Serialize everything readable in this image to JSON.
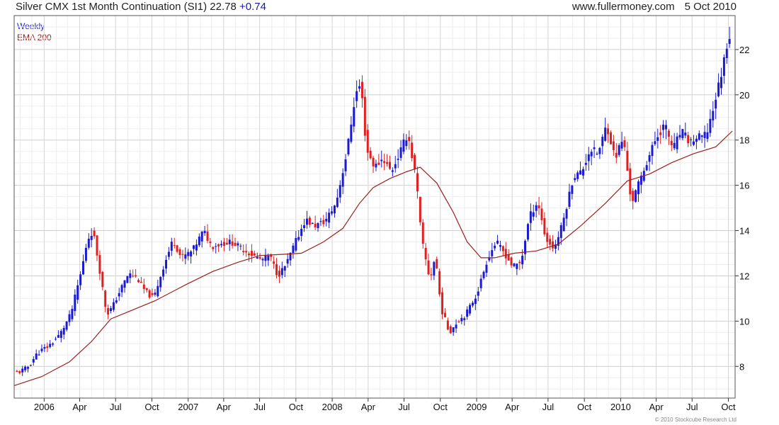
{
  "header": {
    "title": "Silver CMX 1st Month Continuation (SI1)",
    "last": "22.78",
    "change": "+0.74",
    "site": "www.fullermoney.com",
    "date": "5 Oct 2010"
  },
  "footer": {
    "copyright": "© 2010 Stockcube Research Ltd"
  },
  "chart_data": {
    "type": "candlestick",
    "period": "Weekly",
    "legend": [
      "Weekly",
      "EMA 200"
    ],
    "legend_placement": "top-left",
    "ylim": [
      6.6,
      23.5
    ],
    "yticks": [
      8,
      10,
      12,
      14,
      16,
      18,
      20,
      22
    ],
    "x_range": [
      "2005-10-17",
      "2010-10-18"
    ],
    "xticks": [
      {
        "date": "2006-01-01",
        "label": "2006"
      },
      {
        "date": "2006-04-01",
        "label": "Apr"
      },
      {
        "date": "2006-07-01",
        "label": "Jul"
      },
      {
        "date": "2006-10-01",
        "label": "Oct"
      },
      {
        "date": "2007-01-01",
        "label": "2007"
      },
      {
        "date": "2007-04-01",
        "label": "Apr"
      },
      {
        "date": "2007-07-01",
        "label": "Jul"
      },
      {
        "date": "2007-10-01",
        "label": "Oct"
      },
      {
        "date": "2008-01-01",
        "label": "2008"
      },
      {
        "date": "2008-04-01",
        "label": "Apr"
      },
      {
        "date": "2008-07-01",
        "label": "Jul"
      },
      {
        "date": "2008-10-01",
        "label": "Oct"
      },
      {
        "date": "2009-01-01",
        "label": "2009"
      },
      {
        "date": "2009-04-01",
        "label": "Apr"
      },
      {
        "date": "2009-07-01",
        "label": "Jul"
      },
      {
        "date": "2009-10-01",
        "label": "Oct"
      },
      {
        "date": "2010-01-01",
        "label": "2010"
      },
      {
        "date": "2010-04-01",
        "label": "Apr"
      },
      {
        "date": "2010-07-01",
        "label": "Jul"
      },
      {
        "date": "2010-10-01",
        "label": "Oct"
      }
    ],
    "grid": true,
    "colors": {
      "up": "#1a1ad0",
      "down": "#e02020",
      "ema": "#9b2020",
      "grid": "#d8d8d8"
    },
    "price_path": [
      [
        "2005-10-24",
        7.7
      ],
      [
        "2005-11-21",
        7.9
      ],
      [
        "2005-12-19",
        8.6
      ],
      [
        "2006-01-16",
        8.9
      ],
      [
        "2006-02-13",
        9.4
      ],
      [
        "2006-03-13",
        10.3
      ],
      [
        "2006-04-10",
        12.3
      ],
      [
        "2006-04-24",
        13.6
      ],
      [
        "2006-05-08",
        14.0
      ],
      [
        "2006-05-22",
        12.6
      ],
      [
        "2006-06-12",
        10.3
      ],
      [
        "2006-06-26",
        10.6
      ],
      [
        "2006-07-17",
        11.4
      ],
      [
        "2006-08-07",
        12.1
      ],
      [
        "2006-08-28",
        11.9
      ],
      [
        "2006-09-18",
        11.3
      ],
      [
        "2006-10-09",
        11.0
      ],
      [
        "2006-10-30",
        12.2
      ],
      [
        "2006-11-27",
        13.6
      ],
      [
        "2006-12-18",
        12.8
      ],
      [
        "2007-01-15",
        13.1
      ],
      [
        "2007-02-12",
        14.0
      ],
      [
        "2007-03-05",
        13.3
      ],
      [
        "2007-03-26",
        13.4
      ],
      [
        "2007-04-23",
        13.5
      ],
      [
        "2007-05-21",
        13.2
      ],
      [
        "2007-06-18",
        12.9
      ],
      [
        "2007-07-09",
        12.7
      ],
      [
        "2007-07-30",
        12.9
      ],
      [
        "2007-08-20",
        12.0
      ],
      [
        "2007-09-10",
        12.5
      ],
      [
        "2007-10-01",
        13.4
      ],
      [
        "2007-10-29",
        14.5
      ],
      [
        "2007-11-19",
        14.2
      ],
      [
        "2007-12-17",
        14.4
      ],
      [
        "2008-01-14",
        15.2
      ],
      [
        "2008-02-11",
        17.5
      ],
      [
        "2008-03-03",
        20.0
      ],
      [
        "2008-03-17",
        20.5
      ],
      [
        "2008-03-31",
        17.6
      ],
      [
        "2008-04-21",
        16.8
      ],
      [
        "2008-05-12",
        17.2
      ],
      [
        "2008-06-02",
        16.6
      ],
      [
        "2008-06-23",
        17.4
      ],
      [
        "2008-07-14",
        18.3
      ],
      [
        "2008-08-04",
        16.3
      ],
      [
        "2008-08-18",
        13.6
      ],
      [
        "2008-09-08",
        11.8
      ],
      [
        "2008-09-22",
        12.9
      ],
      [
        "2008-10-06",
        10.6
      ],
      [
        "2008-10-27",
        9.5
      ],
      [
        "2008-11-17",
        10.0
      ],
      [
        "2008-12-08",
        10.3
      ],
      [
        "2009-01-05",
        11.2
      ],
      [
        "2009-02-02",
        12.8
      ],
      [
        "2009-02-23",
        13.5
      ],
      [
        "2009-03-16",
        13.0
      ],
      [
        "2009-04-06",
        12.4
      ],
      [
        "2009-04-27",
        12.6
      ],
      [
        "2009-05-18",
        14.6
      ],
      [
        "2009-06-08",
        15.3
      ],
      [
        "2009-06-29",
        13.6
      ],
      [
        "2009-07-20",
        13.2
      ],
      [
        "2009-08-10",
        14.3
      ],
      [
        "2009-09-07",
        16.4
      ],
      [
        "2009-09-28",
        16.6
      ],
      [
        "2009-10-19",
        17.6
      ],
      [
        "2009-11-09",
        17.4
      ],
      [
        "2009-11-30",
        18.7
      ],
      [
        "2009-12-21",
        17.2
      ],
      [
        "2010-01-11",
        18.1
      ],
      [
        "2010-02-01",
        15.2
      ],
      [
        "2010-02-22",
        16.2
      ],
      [
        "2010-03-15",
        17.2
      ],
      [
        "2010-04-05",
        18.1
      ],
      [
        "2010-04-26",
        18.7
      ],
      [
        "2010-05-17",
        17.6
      ],
      [
        "2010-06-07",
        18.4
      ],
      [
        "2010-06-28",
        17.9
      ],
      [
        "2010-07-19",
        18.1
      ],
      [
        "2010-08-09",
        18.2
      ],
      [
        "2010-08-30",
        19.6
      ],
      [
        "2010-09-20",
        21.2
      ],
      [
        "2010-10-04",
        22.6
      ]
    ],
    "ema_path": [
      [
        "2005-10-17",
        7.15
      ],
      [
        "2005-12-26",
        7.55
      ],
      [
        "2006-03-06",
        8.2
      ],
      [
        "2006-05-01",
        9.1
      ],
      [
        "2006-06-19",
        10.1
      ],
      [
        "2006-08-14",
        10.5
      ],
      [
        "2006-10-09",
        10.9
      ],
      [
        "2006-12-25",
        11.6
      ],
      [
        "2007-03-05",
        12.2
      ],
      [
        "2007-05-07",
        12.6
      ],
      [
        "2007-07-02",
        12.9
      ],
      [
        "2007-08-27",
        12.95
      ],
      [
        "2007-10-15",
        13.0
      ],
      [
        "2007-12-10",
        13.5
      ],
      [
        "2008-01-28",
        14.1
      ],
      [
        "2008-03-10",
        15.2
      ],
      [
        "2008-04-14",
        15.9
      ],
      [
        "2008-05-26",
        16.3
      ],
      [
        "2008-07-07",
        16.6
      ],
      [
        "2008-08-11",
        16.8
      ],
      [
        "2008-09-22",
        16.1
      ],
      [
        "2008-11-03",
        14.8
      ],
      [
        "2008-12-08",
        13.5
      ],
      [
        "2009-01-12",
        12.8
      ],
      [
        "2009-02-16",
        12.8
      ],
      [
        "2009-04-06",
        13.0
      ],
      [
        "2009-06-01",
        13.1
      ],
      [
        "2009-07-27",
        13.4
      ],
      [
        "2009-09-21",
        14.2
      ],
      [
        "2009-11-23",
        15.2
      ],
      [
        "2010-01-18",
        16.2
      ],
      [
        "2010-03-15",
        16.5
      ],
      [
        "2010-05-10",
        17.0
      ],
      [
        "2010-07-05",
        17.4
      ],
      [
        "2010-08-30",
        17.7
      ],
      [
        "2010-10-11",
        18.4
      ]
    ]
  }
}
